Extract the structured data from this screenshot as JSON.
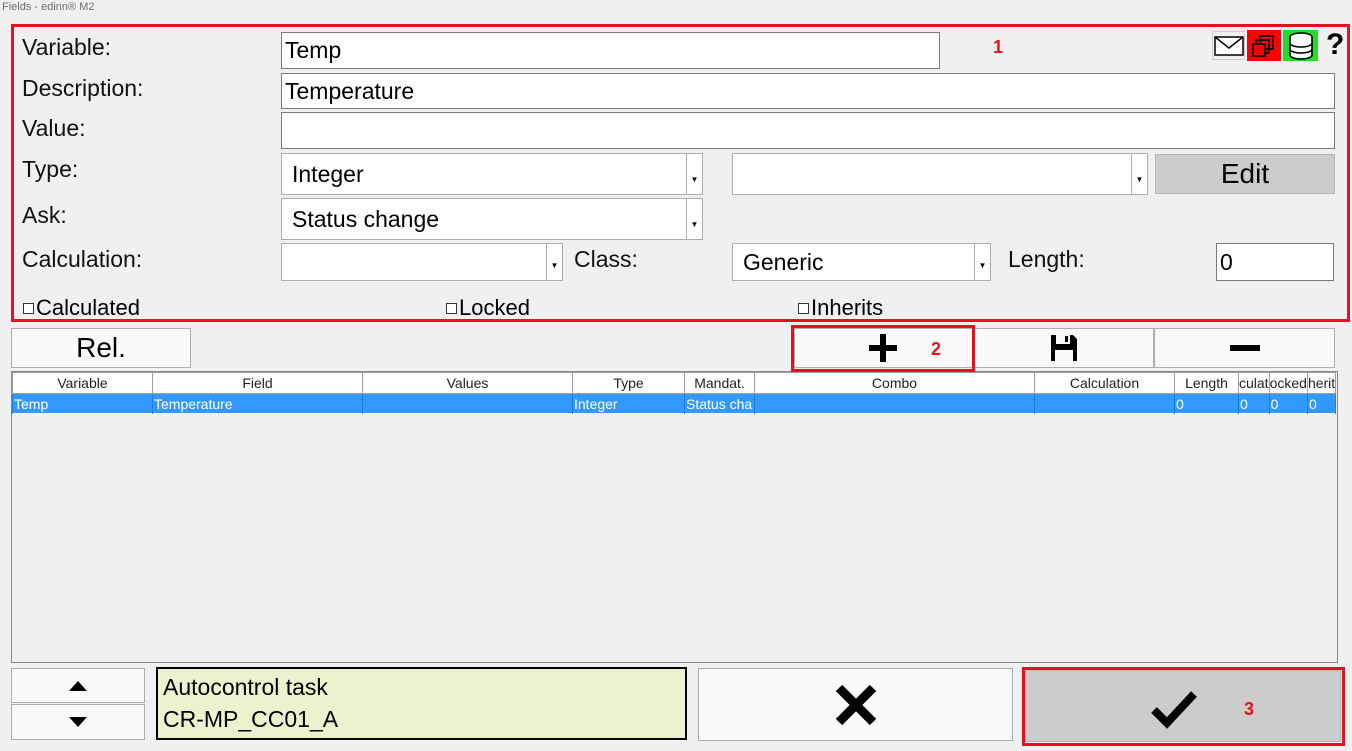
{
  "window": {
    "title": "Fields - edinn® M2"
  },
  "form": {
    "variable_label": "Variable:",
    "variable_value": "Temp",
    "description_label": "Description:",
    "description_value": "Temperature",
    "value_label": "Value:",
    "value_value": "",
    "type_label": "Type:",
    "type_value": "Integer",
    "type_secondary_value": "",
    "edit_label": "Edit",
    "ask_label": "Ask:",
    "ask_value": "Status change",
    "calculation_label": "Calculation:",
    "calculation_value": "",
    "class_label": "Class:",
    "class_value": "Generic",
    "length_label": "Length:",
    "length_value": "0",
    "calculated_label": "Calculated",
    "locked_label": "Locked",
    "inherits_label": "Inherits"
  },
  "header_icons": {
    "mail": "mail-icon",
    "copy": "copy-icon",
    "database": "database-icon",
    "help": "?"
  },
  "toolbar": {
    "rel_label": "Rel.",
    "add_icon": "plus-icon",
    "save_icon": "floppy-icon",
    "remove_icon": "minus-icon"
  },
  "table": {
    "columns": [
      "Variable",
      "Field",
      "Values",
      "Type",
      "Mandat.",
      "Combo",
      "Calculation",
      "Length",
      "culat",
      "ocked",
      "herit"
    ],
    "rows": [
      [
        "Temp",
        "Temperature",
        "",
        "Integer",
        "Status cha",
        "",
        "",
        "0",
        "0",
        "0",
        "0"
      ]
    ]
  },
  "footer": {
    "up_icon": "triangle-up-icon",
    "down_icon": "triangle-down-icon",
    "info_line1": "Autocontrol task",
    "info_line2": "CR-MP_CC01_A",
    "cancel_icon": "x-icon",
    "confirm_icon": "check-icon"
  },
  "annotations": {
    "one": "1",
    "two": "2",
    "three": "3"
  },
  "colors": {
    "annotation_red": "#e3121e",
    "selection_blue": "#3399ff",
    "info_background": "#ebf2cd",
    "copy_icon_bg": "#ff0000",
    "db_icon_bg": "#22dd22"
  }
}
